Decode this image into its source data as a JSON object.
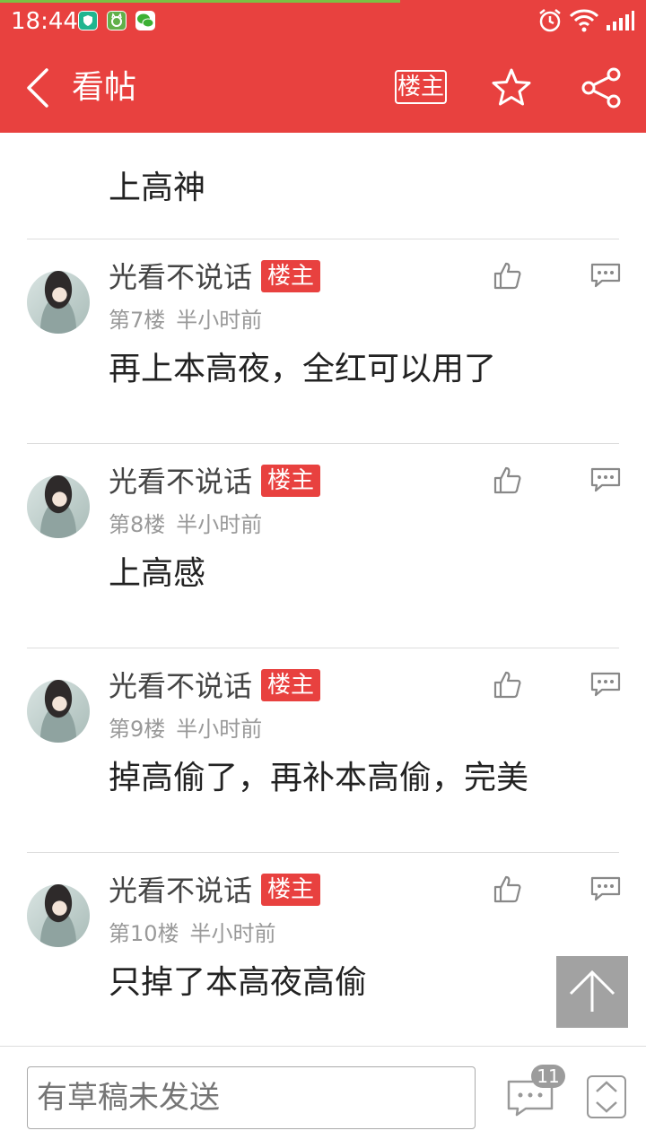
{
  "status_bar": {
    "time": "18:44",
    "app_icons": [
      "shield-app-icon",
      "cat-app-icon",
      "wechat-icon"
    ],
    "right_icons": [
      "alarm-icon",
      "wifi-icon",
      "signal-icon"
    ]
  },
  "app_bar": {
    "title": "看帖",
    "op_filter_label": "楼主"
  },
  "first_post_text": "上高神",
  "posts": [
    {
      "author": "光看不说话",
      "badge": "楼主",
      "floor": "第7楼",
      "time": "半小时前",
      "text": "再上本高夜，全红可以用了"
    },
    {
      "author": "光看不说话",
      "badge": "楼主",
      "floor": "第8楼",
      "time": "半小时前",
      "text": "上高感"
    },
    {
      "author": "光看不说话",
      "badge": "楼主",
      "floor": "第9楼",
      "time": "半小时前",
      "text": "掉高偷了，再补本高偷，完美"
    },
    {
      "author": "光看不说话",
      "badge": "楼主",
      "floor": "第10楼",
      "time": "半小时前",
      "text": "只掉了本高夜高偷"
    }
  ],
  "bottom_bar": {
    "draft_placeholder": "有草稿未发送",
    "comment_count": "11"
  },
  "colors": {
    "brand_red": "#e8413f",
    "badge_red": "#e8413f",
    "muted_gray": "#999999"
  }
}
